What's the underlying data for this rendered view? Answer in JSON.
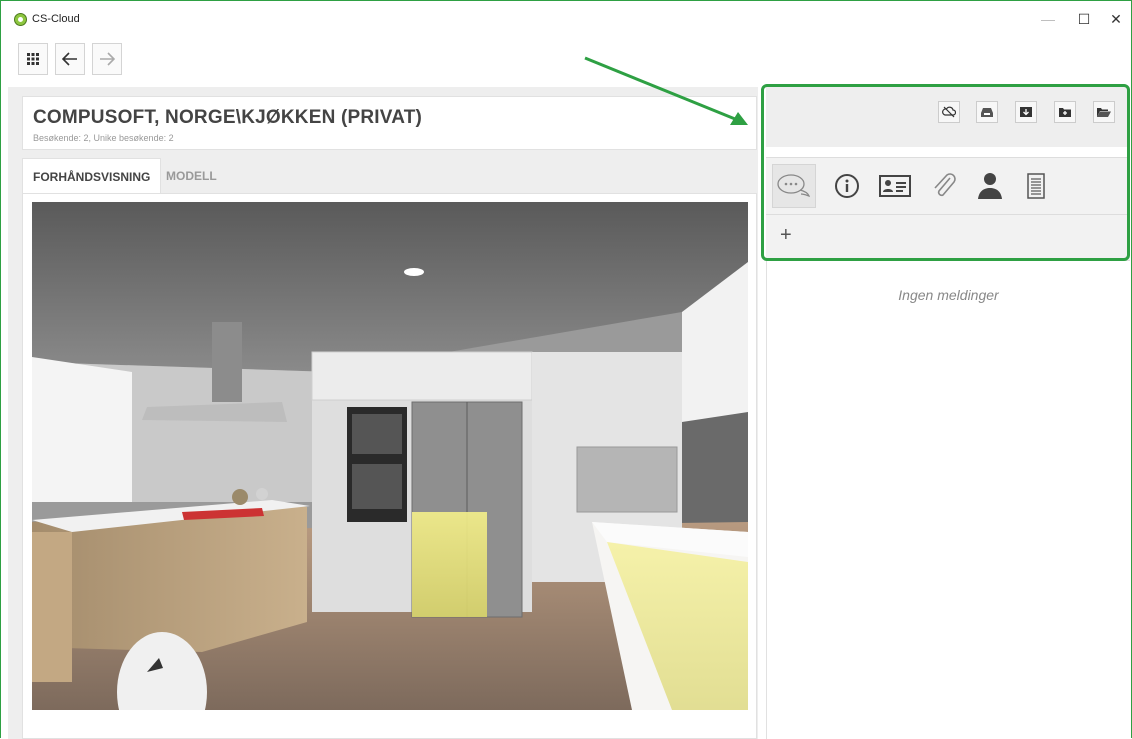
{
  "app": {
    "title": "CS-Cloud"
  },
  "window_controls": {
    "minimize": "—",
    "maximize": "☐",
    "close": "✕"
  },
  "nav": {
    "apps_icon": "grid-icon",
    "back_icon": "arrow-left-icon",
    "forward_icon": "arrow-right-icon"
  },
  "project": {
    "title": "COMPUSOFT, NORGE\\KJØKKEN (PRIVAT)",
    "subtitle": "Besøkende: 2, Unike besøkende: 2"
  },
  "tabs": [
    {
      "label": "FORHÅNDSVISNING",
      "active": true
    },
    {
      "label": "MODELL",
      "active": false
    }
  ],
  "toolbar": {
    "buttons": [
      "cloud-off-icon",
      "inbox-icon",
      "download-box-icon",
      "add-folder-icon",
      "open-folder-icon"
    ]
  },
  "side_tabs": {
    "icons": [
      "chat-bubbles-icon",
      "info-icon",
      "contact-card-icon",
      "paperclip-icon",
      "person-icon",
      "document-icon"
    ],
    "active": 0
  },
  "messages": {
    "add_label": "+",
    "empty_text": "Ingen meldinger"
  },
  "colors": {
    "highlight": "#2ea043",
    "background": "#eeeeee"
  }
}
